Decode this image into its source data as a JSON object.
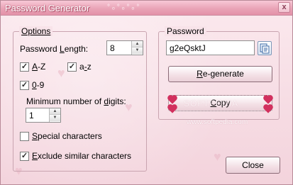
{
  "window": {
    "title": "Password Generator",
    "close_glyph": "x"
  },
  "options": {
    "legend": "Options",
    "length_label_pre": "Password ",
    "length_label_ul": "L",
    "length_label_post": "ength:",
    "length_value": "8",
    "az_upper_ul": "A",
    "az_upper_post": "-Z",
    "az_upper_checked": true,
    "az_lower_pre": "a",
    "az_lower_ul": "-",
    "az_lower_post": "z",
    "az_lower_checked": true,
    "digits_ul": "0",
    "digits_post": "-9",
    "digits_checked": true,
    "min_digits_pre": "Minimum number of ",
    "min_digits_ul": "d",
    "min_digits_post": "igits:",
    "min_digits_value": "1",
    "special_ul": "S",
    "special_post": "pecial characters",
    "special_checked": false,
    "exclude_ul": "E",
    "exclude_post": "xclude similar characters",
    "exclude_checked": true,
    "check_glyph": "✓"
  },
  "password": {
    "legend": "Password",
    "value": "g2eQsktJ",
    "copy_icon": "clipboard-icon",
    "regenerate_ul": "R",
    "regenerate_post": "e-generate",
    "copy_ul": "C",
    "copy_post": "opy"
  },
  "footer": {
    "close_label": "Close"
  },
  "watermark": {
    "brand": "SOFTPEDIA",
    "site": "www.softpedia.com"
  },
  "colors": {
    "titlebar": "#e9a4b7",
    "background": "#f4dde2",
    "heart": "#d2305e"
  }
}
